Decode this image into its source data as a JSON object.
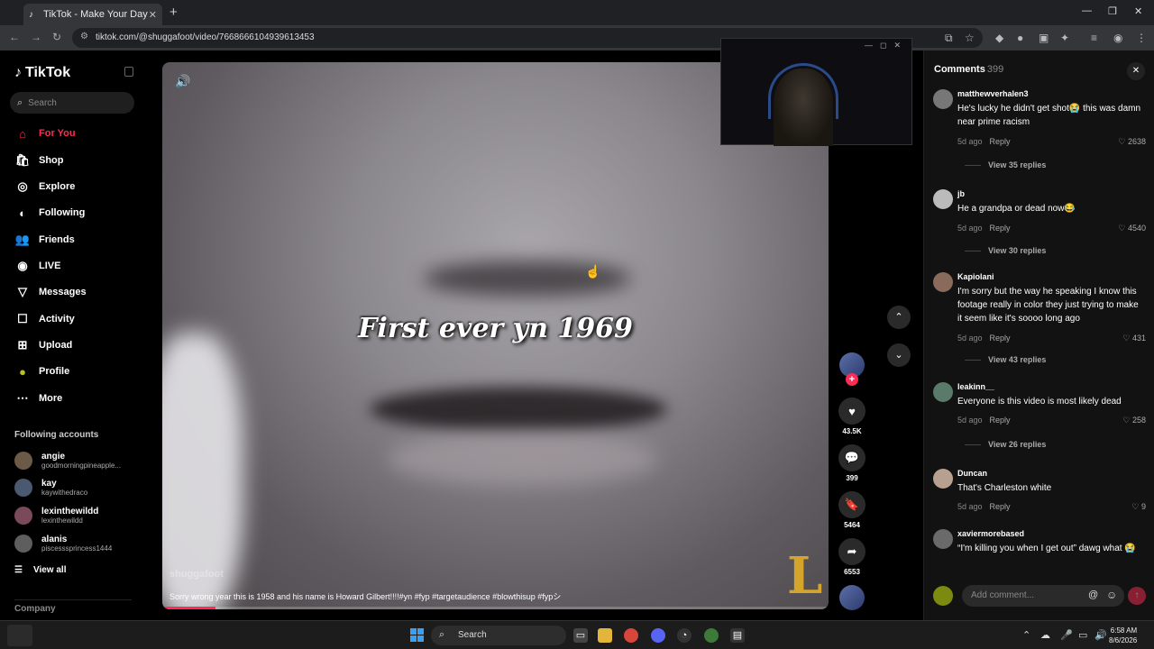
{
  "browser": {
    "tab_title": "TikTok - Make Your Day",
    "url": "tiktok.com/@shuggafoot/video/7668666104939613453"
  },
  "sidebar": {
    "logo": "TikTok",
    "search_placeholder": "Search",
    "nav": [
      {
        "label": "For You",
        "icon": "home-icon",
        "active": true
      },
      {
        "label": "Shop",
        "icon": "shop-icon"
      },
      {
        "label": "Explore",
        "icon": "compass-icon"
      },
      {
        "label": "Following",
        "icon": "following-avatar-icon"
      },
      {
        "label": "Friends",
        "icon": "friends-icon"
      },
      {
        "label": "LIVE",
        "icon": "live-icon"
      },
      {
        "label": "Messages",
        "icon": "messages-icon"
      },
      {
        "label": "Activity",
        "icon": "activity-icon"
      },
      {
        "label": "Upload",
        "icon": "upload-icon"
      },
      {
        "label": "Profile",
        "icon": "profile-avatar-icon"
      },
      {
        "label": "More",
        "icon": "more-icon"
      }
    ],
    "following_title": "Following accounts",
    "accounts": [
      {
        "name": "angie",
        "handle": "goodmorningpineapple..."
      },
      {
        "name": "kay",
        "handle": "kaywithedraco"
      },
      {
        "name": "lexinthewildd",
        "handle": "lexinthewildd"
      },
      {
        "name": "alanis",
        "handle": "piscesssprincess1444"
      }
    ],
    "view_all": "View all",
    "company": "Company"
  },
  "video": {
    "overlay_text": "First ever yn 1969",
    "author": "shuggafoot",
    "caption": "Sorry wrong year this is 1958 and his name is Howard Gilbert!!!!#yn #fyp #targetaudience #blowthisup #fypシ",
    "progress": 0.08
  },
  "actions": {
    "likes": "43.5K",
    "comments": "399",
    "saves": "5464",
    "shares": "6553"
  },
  "comments_panel": {
    "title": "Comments",
    "count": "399",
    "add_placeholder": "Add comment...",
    "items": [
      {
        "user": "matthewverhalen3",
        "text": "He's lucky he didn't get shot😭 this was damn near prime racism",
        "age": "5d ago",
        "reply": "Reply",
        "likes": "2638",
        "replies": "View 35 replies"
      },
      {
        "user": "jb",
        "text": "He a grandpa or dead now😂",
        "age": "5d ago",
        "reply": "Reply",
        "likes": "4540",
        "replies": "View 30 replies"
      },
      {
        "user": "Kapiolani",
        "text": "I'm sorry but the way he speaking I know this footage really in color they just trying to make it seem like it's soooo long ago",
        "age": "5d ago",
        "reply": "Reply",
        "likes": "431",
        "replies": "View 43 replies"
      },
      {
        "user": "leakinn__",
        "text": "Everyone is this video is most likely dead",
        "age": "5d ago",
        "reply": "Reply",
        "likes": "258",
        "replies": "View 26 replies"
      },
      {
        "user": "Duncan",
        "text": "That's Charleston white",
        "age": "5d ago",
        "reply": "Reply",
        "likes": "9",
        "replies": ""
      },
      {
        "user": "xaviermorebased",
        "text": "“I'm killing you when I get out” dawg what 😭",
        "age": "",
        "reply": "",
        "likes": "",
        "replies": ""
      }
    ]
  },
  "taskbar": {
    "search": "Search",
    "time": "6:58 AM",
    "date": "8/6/2026"
  },
  "colors": {
    "accent": "#fe2c55",
    "background": "#000000",
    "panel": "#121212"
  }
}
